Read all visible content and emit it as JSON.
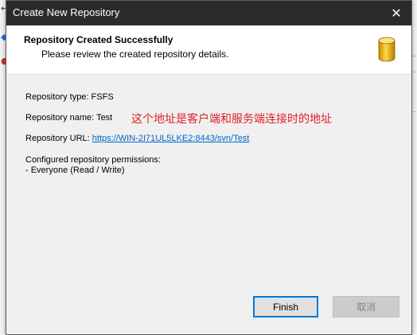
{
  "window": {
    "title": "Create New Repository",
    "close_glyph": "✕"
  },
  "header": {
    "title": "Repository Created Successfully",
    "subtitle": "Please review the created repository details.",
    "icon": "database-icon"
  },
  "details": {
    "type_label": "Repository type: FSFS",
    "name_label": "Repository name: Test",
    "url_label": "Repository URL: ",
    "url_value": "https://WIN-2I71UL5LKE2:8443/svn/Test",
    "permissions_label": "Configured repository permissions:",
    "permissions_entry": "- Everyone (Read / Write)"
  },
  "annotation": "这个地址是客户端和服务端连接时的地址",
  "buttons": {
    "finish": "Finish",
    "cancel": "取消"
  },
  "colors": {
    "titlebar": "#2b2b2b",
    "link": "#0066cc",
    "annotation": "#e0202a",
    "focus": "#0078d7"
  }
}
